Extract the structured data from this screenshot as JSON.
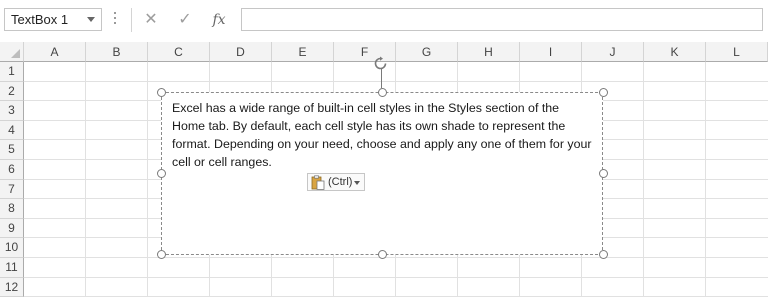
{
  "formula_bar": {
    "name_box": "TextBox 1",
    "cancel_icon": "close-icon",
    "enter_icon": "check-icon",
    "function_label": "fx",
    "formula_value": ""
  },
  "columns": [
    "A",
    "B",
    "C",
    "D",
    "E",
    "F",
    "G",
    "H",
    "I",
    "J",
    "K",
    "L"
  ],
  "rows": [
    "1",
    "2",
    "3",
    "4",
    "5",
    "6",
    "7",
    "8",
    "9",
    "10",
    "11",
    "12"
  ],
  "textbox": {
    "text": "Excel has a wide range of built-in cell styles in the Styles section of the Home tab. By default, each cell style has its own shade to represent the format. Depending on your need, choose and apply any one of them for your cell or cell ranges."
  },
  "paste_options": {
    "label": "(Ctrl)",
    "icon": "clipboard-icon"
  },
  "colors": {
    "grid_line": "#e1e1e1",
    "header_bg": "#f3f3f3",
    "header_border": "#ababab"
  }
}
